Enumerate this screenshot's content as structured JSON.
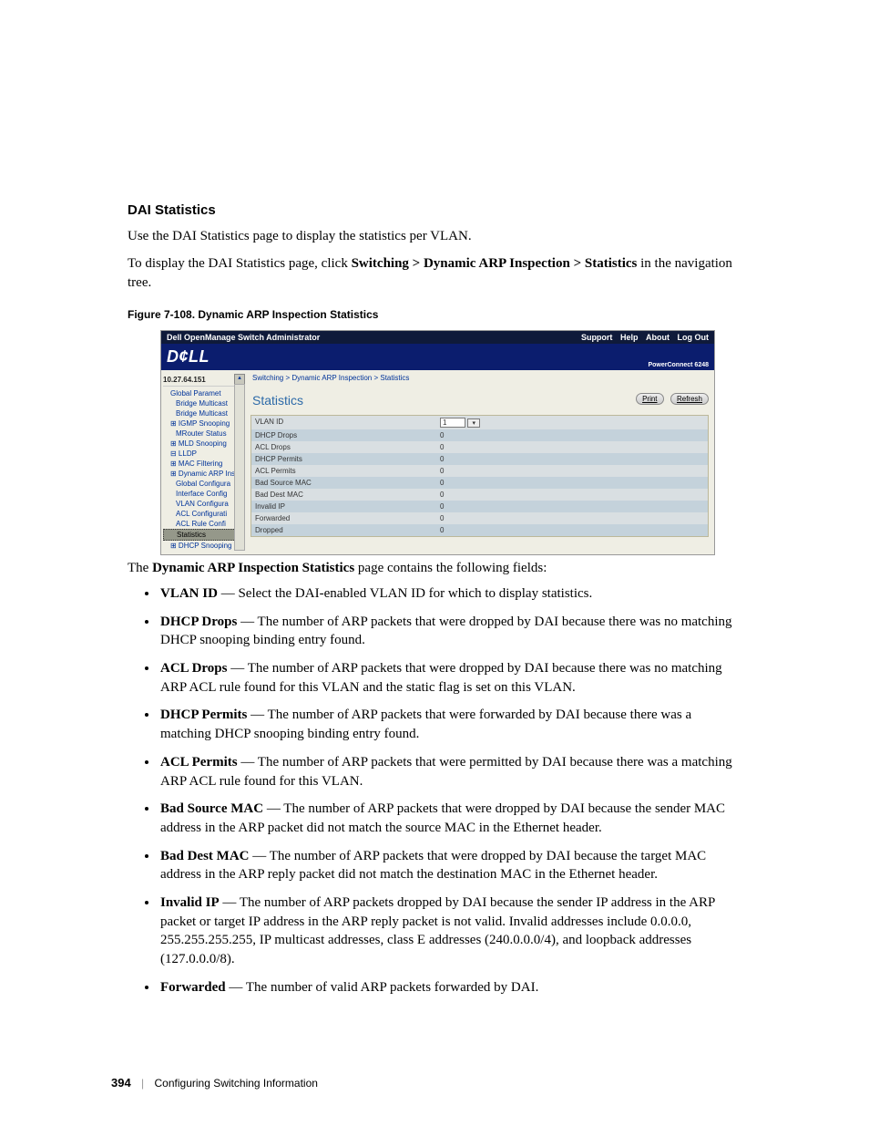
{
  "heading": "DAI Statistics",
  "intro1": "Use the DAI Statistics page to display the statistics per VLAN.",
  "intro2a": "To display the DAI Statistics page, click ",
  "intro2b": "Switching > Dynamic ARP Inspection > Statistics",
  "intro2c": " in the navigation tree.",
  "figcap": "Figure 7-108.    Dynamic ARP Inspection Statistics",
  "fig": {
    "topTitle": "Dell OpenManage Switch Administrator",
    "links": {
      "support": "Support",
      "help": "Help",
      "about": "About",
      "logout": "Log Out"
    },
    "brand": "D¢LL",
    "model": "PowerConnect 6248",
    "ip": "10.27.64.151",
    "nav": [
      "Global Paramet",
      "Bridge Multicast",
      "Bridge Multicast",
      "IGMP Snooping",
      "MRouter Status",
      "MLD Snooping",
      "LLDP",
      "MAC Filtering",
      "Dynamic ARP Insp",
      "Global Configura",
      "Interface Config",
      "VLAN Configura",
      "ACL Configurati",
      "ACL Rule Confi",
      "Statistics",
      "DHCP Snooping"
    ],
    "crumb": "Switching > Dynamic ARP Inspection > Statistics",
    "panelTitle": "Statistics",
    "btnPrint": "Print",
    "btnRefresh": "Refresh",
    "rows": [
      {
        "label": "VLAN ID",
        "value": "1",
        "select": true
      },
      {
        "label": "DHCP Drops",
        "value": "0"
      },
      {
        "label": "ACL Drops",
        "value": "0"
      },
      {
        "label": "DHCP Permits",
        "value": "0"
      },
      {
        "label": "ACL Permits",
        "value": "0"
      },
      {
        "label": "Bad Source MAC",
        "value": "0"
      },
      {
        "label": "Bad Dest MAC",
        "value": "0"
      },
      {
        "label": "Invalid IP",
        "value": "0"
      },
      {
        "label": "Forwarded",
        "value": "0"
      },
      {
        "label": "Dropped",
        "value": "0"
      }
    ]
  },
  "afterFigA": "The ",
  "afterFigB": "Dynamic ARP Inspection Statistics",
  "afterFigC": " page contains the following fields:",
  "fields": [
    {
      "term": "VLAN ID",
      "desc": " — Select the DAI-enabled VLAN ID for which to display statistics."
    },
    {
      "term": "DHCP Drops",
      "desc": " — The number of ARP packets that were dropped by DAI because there was no matching DHCP snooping binding entry found."
    },
    {
      "term": "ACL Drops",
      "desc": " — The number of ARP packets that were dropped by DAI because there was no matching ARP ACL rule found for this VLAN and the static flag is set on this VLAN."
    },
    {
      "term": "DHCP Permits",
      "desc": " — The number of ARP packets that were forwarded by DAI because there was a matching DHCP snooping binding entry found."
    },
    {
      "term": "ACL Permits",
      "desc": " — The number of ARP packets that were permitted by DAI because there was a matching ARP ACL rule found for this VLAN."
    },
    {
      "term": "Bad Source MAC",
      "desc": " — The number of ARP packets that were dropped by DAI because the sender MAC address in the ARP packet did not match the source MAC in the Ethernet header."
    },
    {
      "term": "Bad Dest MAC",
      "desc": " — The number of ARP packets that were dropped by DAI because the target MAC address in the ARP reply packet did not match the destination MAC in the Ethernet header."
    },
    {
      "term": "Invalid IP",
      "desc": " — The number of ARP packets dropped by DAI because the sender IP address in the ARP packet or target IP address in the ARP reply packet is not valid. Invalid addresses include 0.0.0.0, 255.255.255.255, IP multicast addresses, class E addresses (240.0.0.0/4), and loopback addresses (127.0.0.0/8)."
    },
    {
      "term": "Forwarded",
      "desc": " — The number of valid ARP packets forwarded by DAI."
    }
  ],
  "footer": {
    "page": "394",
    "section": "Configuring Switching Information"
  }
}
